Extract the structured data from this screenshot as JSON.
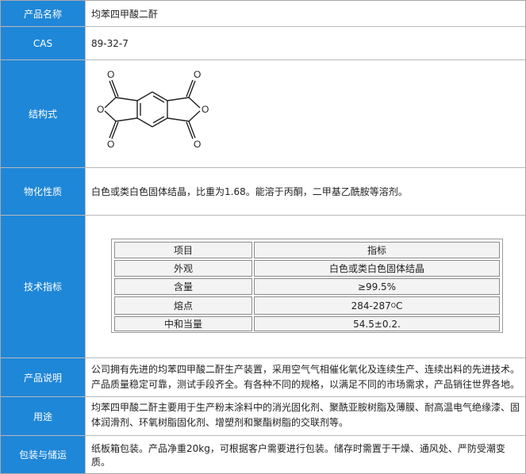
{
  "rows": {
    "name": {
      "label": "产品名称",
      "value": "均苯四甲酸二酐"
    },
    "cas": {
      "label": "CAS",
      "value": "89-32-7"
    },
    "structure": {
      "label": "结构式",
      "atom_O": "O"
    },
    "props": {
      "label": "物化性质",
      "value": "白色或类白色固体结晶，比重为1.68。能溶于丙酮，二甲基乙酰胺等溶剂。"
    },
    "spec": {
      "label": "技术指标"
    },
    "desc": {
      "label": "产品说明",
      "line1": "公司拥有先进的均苯四甲酸二酐生产装置，采用空气气相催化氧化及连续生产、连续出料的先进技术。",
      "line2": "产品质量稳定可靠，测试手段齐全。有各种不同的规格，以满足不同的市场需求，产品销往世界各地。"
    },
    "use": {
      "label": "用途",
      "line1": "均苯四甲酸二酐主要用于生产粉末涂料中的消光固化剂、聚酰亚胺树脂及薄膜、耐高温电气绝缘漆、固",
      "line2": "体润滑剂、环氧树脂固化剂、增塑剂和聚酯树脂的交联剂等。"
    },
    "pack": {
      "label": "包装与储运",
      "value": "纸板箱包装。产品净重20kg，可根据客户需要进行包装。储存时需置于干燥、通风处、严防受潮变质。"
    }
  },
  "spec_table": {
    "headers": [
      "项目",
      "指标"
    ],
    "rows": [
      {
        "item": "外观",
        "value": "白色或类白色固体结晶"
      },
      {
        "item": "含量",
        "value": "≥99.5%"
      },
      {
        "item": "熔点",
        "value": "284-287",
        "unit_sup": "O",
        "unit": "C"
      },
      {
        "item": "中和当量",
        "value": "54.5±0.2."
      }
    ]
  }
}
